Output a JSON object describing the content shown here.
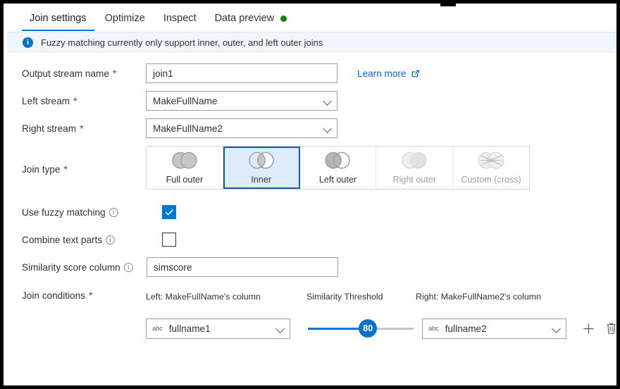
{
  "tabs": [
    {
      "label": "Join settings",
      "active": true,
      "dot": false
    },
    {
      "label": "Optimize",
      "active": false,
      "dot": false
    },
    {
      "label": "Inspect",
      "active": false,
      "dot": false
    },
    {
      "label": "Data preview",
      "active": false,
      "dot": true
    }
  ],
  "info_banner": {
    "icon": "info-icon",
    "text": "Fuzzy matching currently only support inner, outer, and left outer joins"
  },
  "fields": {
    "output_stream": {
      "label": "Output stream name",
      "required": "*",
      "value": "join1"
    },
    "left_stream": {
      "label": "Left stream",
      "required": "*",
      "value": "MakeFullName"
    },
    "right_stream": {
      "label": "Right stream",
      "required": "*",
      "value": "MakeFullName2"
    },
    "learn_more": {
      "label": "Learn more",
      "icon": "external-link-icon"
    }
  },
  "join_type": {
    "label": "Join type",
    "required": "*",
    "selected": "Inner",
    "options": [
      {
        "label": "Full outer",
        "icon": "venn-full-outer-icon",
        "disabled": false,
        "selected": false
      },
      {
        "label": "Inner",
        "icon": "venn-inner-icon",
        "disabled": false,
        "selected": true
      },
      {
        "label": "Left outer",
        "icon": "venn-left-outer-icon",
        "disabled": false,
        "selected": false
      },
      {
        "label": "Right outer",
        "icon": "venn-right-outer-icon",
        "disabled": true,
        "selected": false
      },
      {
        "label": "Custom (cross)",
        "icon": "venn-cross-icon",
        "disabled": true,
        "selected": false
      }
    ]
  },
  "fuzzy": {
    "use_fuzzy_matching": {
      "label": "Use fuzzy matching",
      "checked": true
    },
    "combine_text_parts": {
      "label": "Combine text parts",
      "checked": false
    },
    "similarity_score_column": {
      "label": "Similarity score column",
      "value": "simscore"
    }
  },
  "join_conditions": {
    "label": "Join conditions",
    "required": "*",
    "column_headers": {
      "left": "Left: MakeFullName's column",
      "middle": "Similarity Threshold",
      "right": "Right: MakeFullName2's column"
    },
    "rows": [
      {
        "left_column": {
          "type_badge": "abc",
          "value": "fullname1"
        },
        "threshold": 80,
        "threshold_min": 0,
        "threshold_max": 100,
        "right_column": {
          "type_badge": "abc",
          "value": "fullname2"
        },
        "add_icon": "plus-icon",
        "delete_icon": "trash-icon"
      }
    ]
  },
  "colors": {
    "accent": "#0078d4",
    "accent_dark": "#0b5cab",
    "selected_bg": "#deecf9",
    "banner_bg": "#eff6fc",
    "required_red": "#a4262c",
    "link_blue": "#0366d6",
    "status_green": "#108010"
  }
}
